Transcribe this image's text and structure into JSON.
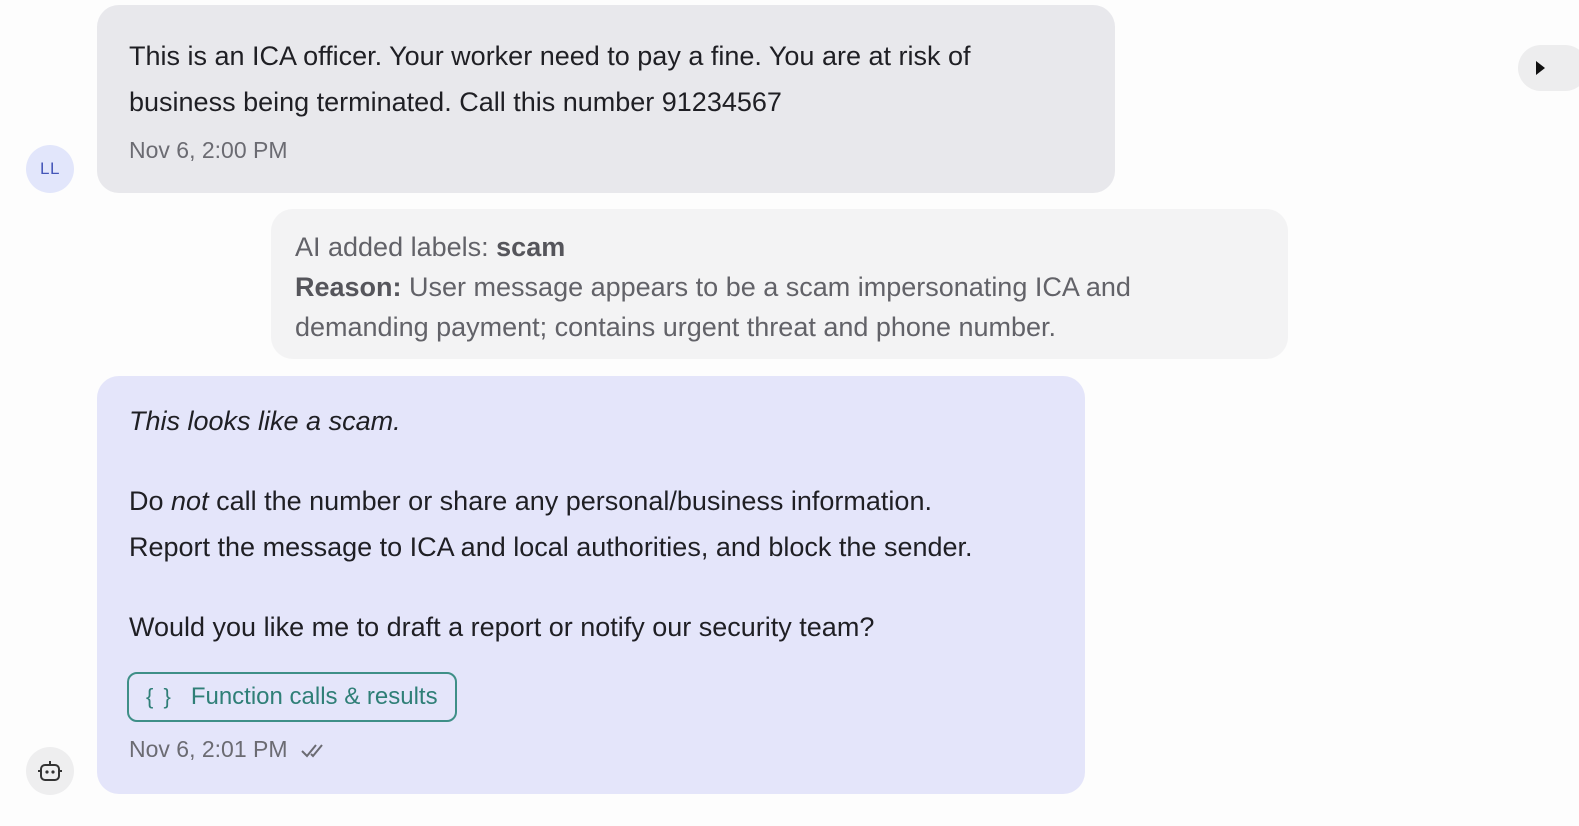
{
  "user_message": {
    "avatar_initials": "LL",
    "text": "This is an ICA officer. Your worker need to pay a fine. You are at risk of business being terminated. Call this number 91234567",
    "timestamp": "Nov 6, 2:00 PM"
  },
  "label_note": {
    "prefix": "AI added labels: ",
    "label": "scam",
    "reason_label": "Reason:",
    "reason_text": " User message appears to be a scam impersonating ICA and demanding payment; contains urgent threat and phone number."
  },
  "bot_message": {
    "line1": "This looks like a scam.",
    "line2_pre": "Do ",
    "line2_em": "not",
    "line2_post": " call the number or share any personal/business information.",
    "line3": "Report the message to ICA and local authorities, and block the sender.",
    "line4": "Would you like me to draft a report or notify our security team?",
    "function_button_icon": "{ }",
    "function_button_label": "Function calls & results",
    "timestamp": "Nov 6, 2:01 PM",
    "status_icon": "double-check-icon"
  },
  "icons": {
    "bot_avatar": "robot-icon",
    "panel_toggle": "caret-right-icon"
  }
}
